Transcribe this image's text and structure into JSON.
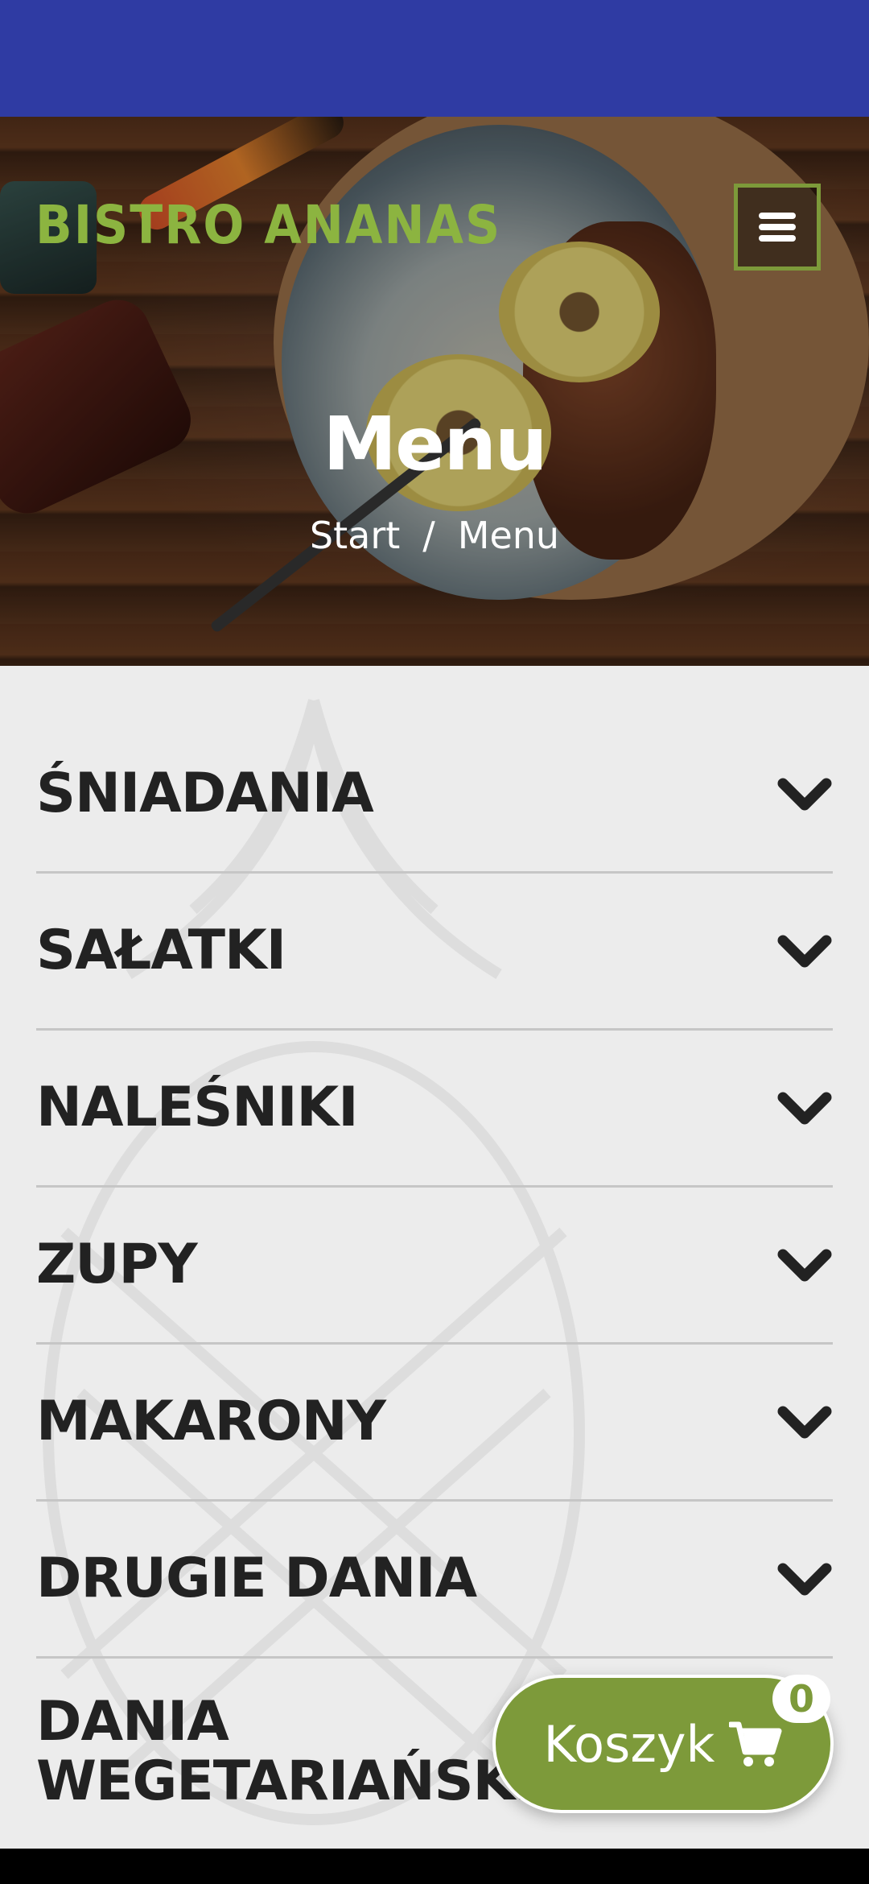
{
  "header": {
    "logo_text": "BISTRO ANANAS",
    "menu_icon": "hamburger-icon"
  },
  "hero": {
    "title": "Menu",
    "breadcrumb": {
      "home": "Start",
      "separator": "/",
      "current": "Menu"
    }
  },
  "categories": [
    {
      "label": "ŚNIADANIA",
      "icon": "chevron-down-icon"
    },
    {
      "label": "SAŁATKI",
      "icon": "chevron-down-icon"
    },
    {
      "label": "NALEŚNIKI",
      "icon": "chevron-down-icon"
    },
    {
      "label": "ZUPY",
      "icon": "chevron-down-icon"
    },
    {
      "label": "MAKARONY",
      "icon": "chevron-down-icon"
    },
    {
      "label": "DRUGIE DANIA",
      "icon": "chevron-down-icon"
    },
    {
      "label": "DANIA WEGETARIAŃSKIE",
      "icon": "chevron-down-icon"
    }
  ],
  "cart": {
    "label": "Koszyk",
    "count": "0",
    "icon": "cart-icon"
  },
  "colors": {
    "status_bar": "#2f3ba3",
    "brand_green": "#7d9a3a",
    "logo_green": "#8cb440",
    "page_bg": "#ececec",
    "text_dark": "#222222"
  }
}
